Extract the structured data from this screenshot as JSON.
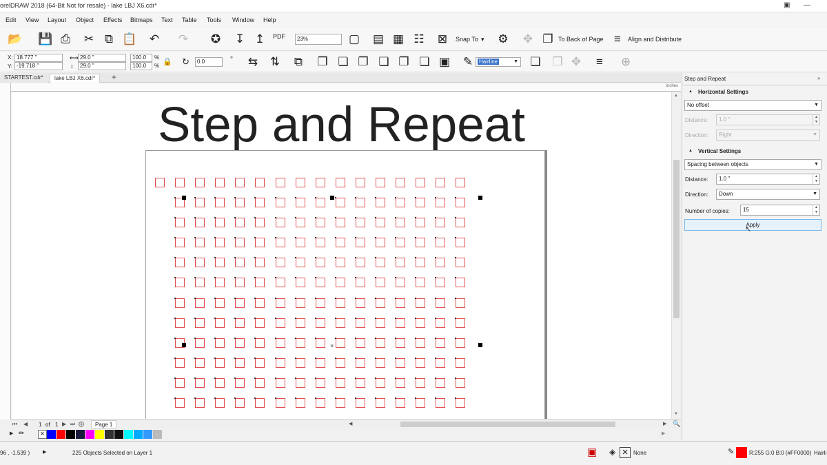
{
  "app": {
    "title": "orelDRAW 2018 (64-Bit Not for resale) - lake LBJ X6.cdr*"
  },
  "menu": [
    "Edit",
    "View",
    "Layout",
    "Object",
    "Effects",
    "Bitmaps",
    "Text",
    "Table",
    "Tools",
    "Window",
    "Help"
  ],
  "toolbar": {
    "zoom": "23%",
    "snap_to": "Snap To",
    "to_back": "To Back of Page",
    "align": "Align and Distribute",
    "pdf": "PDF"
  },
  "propbar": {
    "x": "18.777 \"",
    "y": "-19.718 \"",
    "w": "29.0 \"",
    "h": "29.0 \"",
    "sx": "100.0",
    "sy": "100.0",
    "pct": "%",
    "angle": "0.0",
    "deg": "°",
    "outline": "Hairline",
    "x_lbl": "X:",
    "y_lbl": "Y:"
  },
  "tabs": [
    "STARTEST.cdr*",
    "lake LBJ X6.cdr*"
  ],
  "ruler": {
    "unit": "inches"
  },
  "canvas": {
    "heading": "Step and Repeat",
    "grid_cols": 15,
    "grid_rows": 11,
    "extra_top_row": 16
  },
  "pagebar": {
    "page_num": "1",
    "of": "of",
    "total": "1",
    "page_tab": "Page 1"
  },
  "palette": {
    "colors": [
      "#0000ff",
      "#ff0000",
      "#000000",
      "#1a1a3a",
      "#ff00ff",
      "#ffff00",
      "#333333",
      "#111111",
      "#00ffff",
      "#00aaff",
      "#3399ff",
      "#bbbbbb"
    ]
  },
  "status": {
    "coords": "96 , -1.539 )",
    "selection": "225 Objects Selected on Layer 1",
    "fill": "None",
    "outline_color": "R:255 G:0 B:0 (#FF0000)",
    "outline_width": "Hairli",
    "outline_hex": "#ff0000"
  },
  "docker": {
    "title": "Step and Repeat",
    "horizontal": {
      "title": "Horizontal Settings",
      "mode": "No offset",
      "distance_label": "Distance:",
      "distance": "1.0 \"",
      "direction_label": "Direction:",
      "direction": "Right"
    },
    "vertical": {
      "title": "Vertical Settings",
      "mode": "Spacing between objects",
      "distance_label": "Distance:",
      "distance": "1.0 \"",
      "direction_label": "Direction:",
      "direction": "Down"
    },
    "copies_label": "Number of copies:",
    "copies": "15",
    "apply": "Apply"
  }
}
